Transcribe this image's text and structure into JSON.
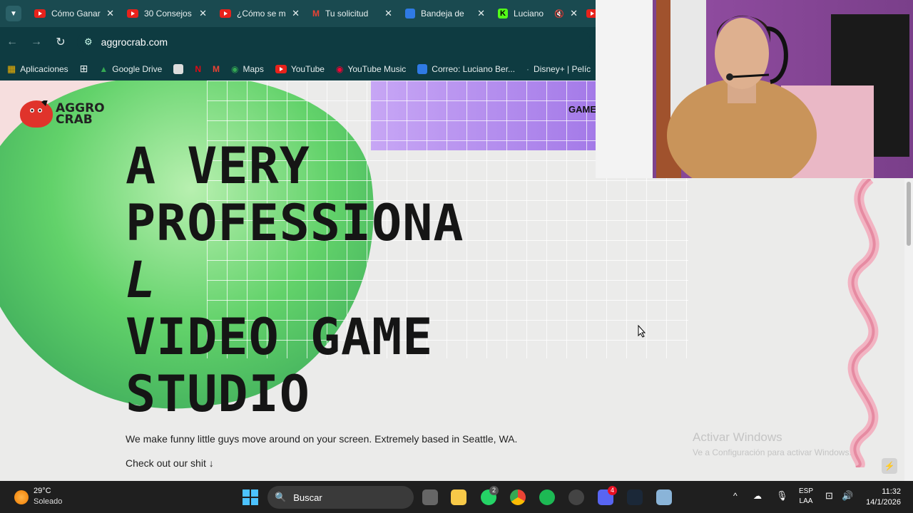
{
  "browser": {
    "tabs": [
      {
        "title": "Cómo Ganar",
        "icon": "youtube-icon"
      },
      {
        "title": "30 Consejos",
        "icon": "youtube-icon"
      },
      {
        "title": "¿Cómo se m",
        "icon": "youtube-icon"
      },
      {
        "title": "Tu solicitud",
        "icon": "gmail-icon"
      },
      {
        "title": "Bandeja de",
        "icon": "outlook-icon"
      },
      {
        "title": "Luciano",
        "icon": "kick-icon"
      }
    ],
    "url": "aggrocrab.com",
    "bookmarks": [
      "Aplicaciones",
      "Google Drive",
      "Maps",
      "YouTube",
      "YouTube Music",
      "Correo: Luciano Ber...",
      "Disney+ | Pelíc"
    ]
  },
  "site": {
    "logo_text_1": "AGGRO",
    "logo_text_2": "CRAB",
    "nav_games": "GAME",
    "hero": [
      "A VERY",
      "PROFESSIONA",
      "L",
      "VIDEO GAME",
      "STUDIO"
    ],
    "subtitle": "We make funny little guys move around on your screen. Extremely based in Seattle, WA.",
    "cta": "Check out our shit ↓"
  },
  "watermark": {
    "line1": "Activar Windows",
    "line2": "Ve a Configuración para activar Windows."
  },
  "taskbar": {
    "temp": "29°C",
    "weather": "Soleado",
    "search": "Buscar",
    "lang1": "ESP",
    "lang2": "LAA",
    "time": "11:32",
    "date": "14/1/2026",
    "whatsapp_badge": "2",
    "discord_badge": "4"
  },
  "colors": {
    "tab_bg": "#1a4a50",
    "toolbar_bg": "#0e3b41",
    "accent_green": "#62d26a",
    "accent_purple": "#b28df0"
  }
}
